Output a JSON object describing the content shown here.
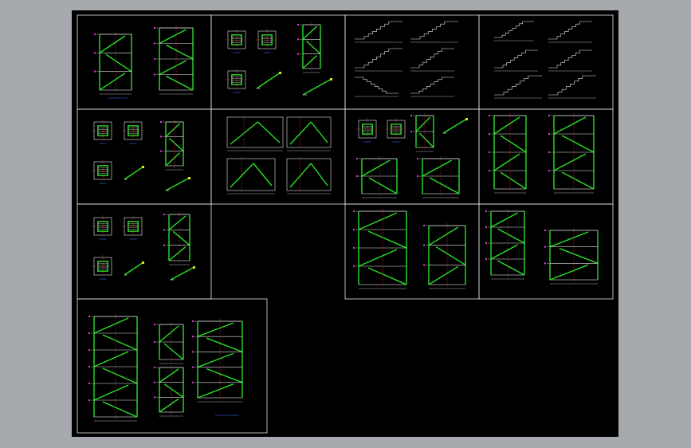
{
  "sheet": {
    "background": "#000000",
    "outer_background": "#a6a9ae",
    "line_color": "#e6e6e6",
    "stair_color": "#27e027",
    "grid_color": "#e03030"
  }
}
